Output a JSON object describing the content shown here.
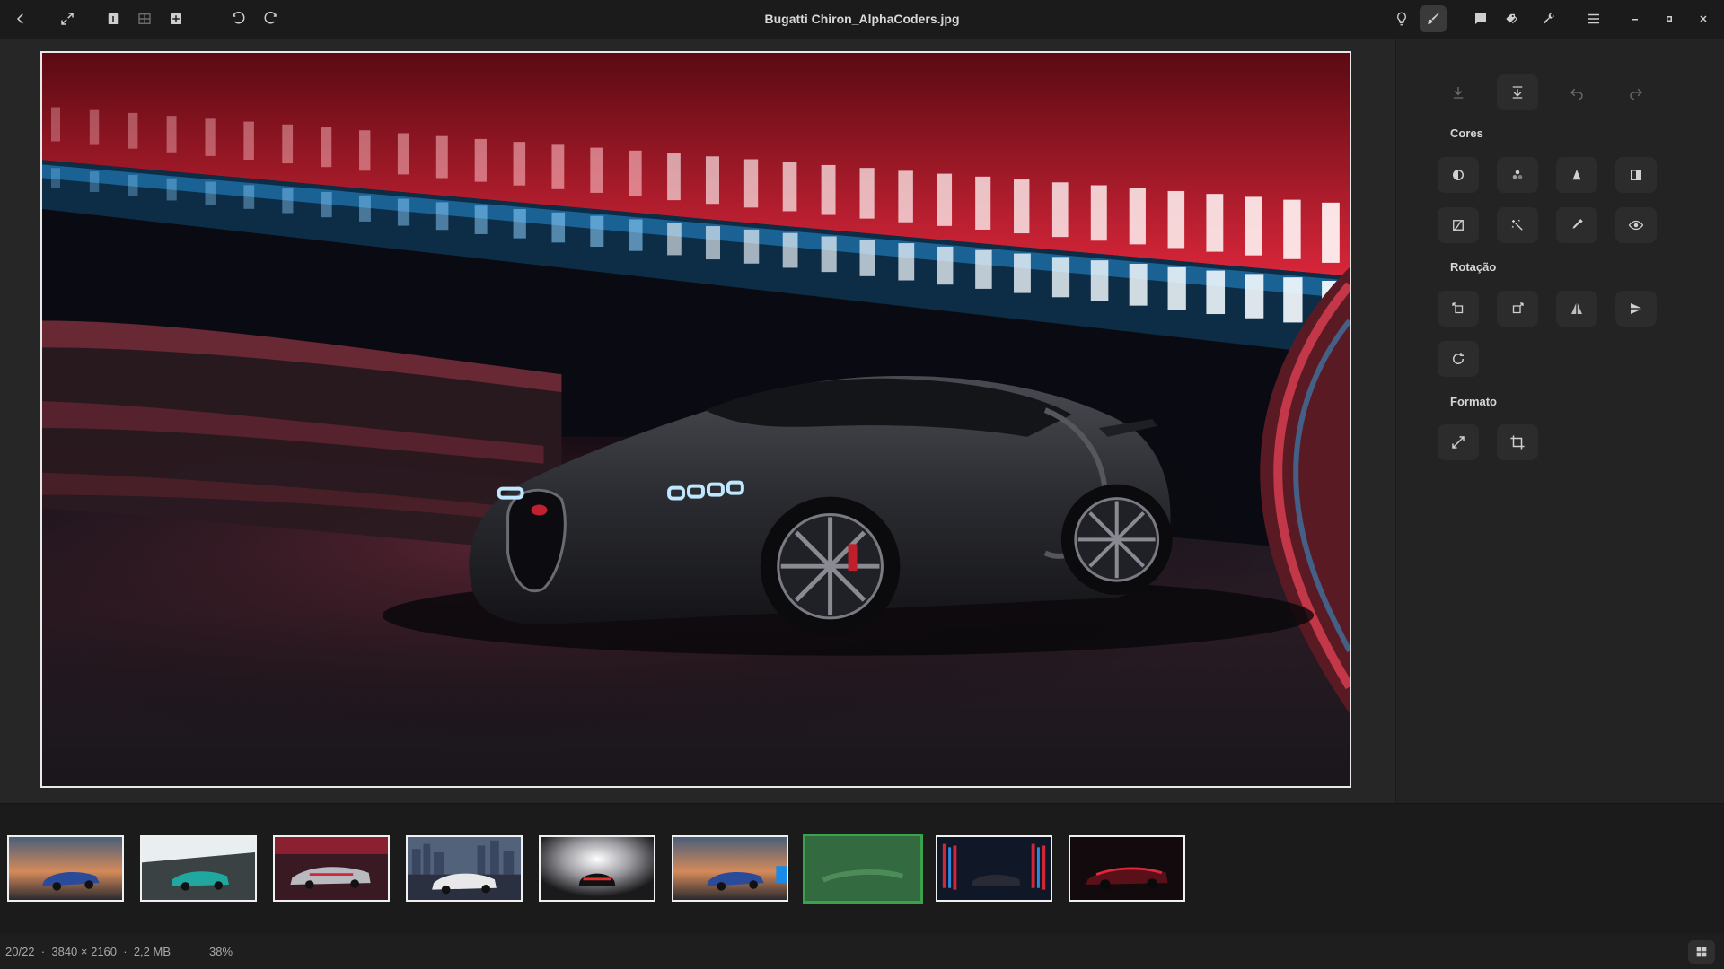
{
  "window": {
    "title": "Bugatti Chiron_AlphaCoders.jpg"
  },
  "header": {
    "left_icons": [
      "back-icon",
      "fullscreen-icon",
      "single-page-icon",
      "double-page-icon",
      "add-icon",
      "undo-icon",
      "redo-icon"
    ],
    "right_icons": [
      "lightbulb-icon",
      "brush-icon",
      "comment-icon",
      "tags-icon",
      "wrench-icon",
      "menu-icon",
      "minimize-icon",
      "maximize-icon",
      "close-icon"
    ]
  },
  "panel": {
    "top_icons": [
      "download-icon",
      "download-bar-icon",
      "undo-icon",
      "redo-icon"
    ],
    "sections": {
      "colors": "Cores",
      "rotation": "Rotação",
      "format": "Formato"
    },
    "color_tools": [
      "contrast-icon",
      "channels-icon",
      "sharpen-icon",
      "levels-icon",
      "curves-icon",
      "magic-wand-icon",
      "eyedropper-icon",
      "eye-icon"
    ],
    "rotation_tools": [
      "rotate-left-icon",
      "rotate-right-icon",
      "flip-horizontal-icon",
      "flip-vertical-icon",
      "rotate-free-icon"
    ],
    "format_tools": [
      "resize-icon",
      "crop-icon"
    ]
  },
  "filmstrip": {
    "count": 9,
    "selected_index": 6
  },
  "status": {
    "position": "20/22",
    "dimensions": "3840 × 2160",
    "size": "2,2 MB",
    "zoom": "38%",
    "separator": "·"
  },
  "colors": {
    "selected_border": "#3aa24c",
    "neon_red": "#e0283a",
    "neon_blue": "#3aa8e8"
  }
}
